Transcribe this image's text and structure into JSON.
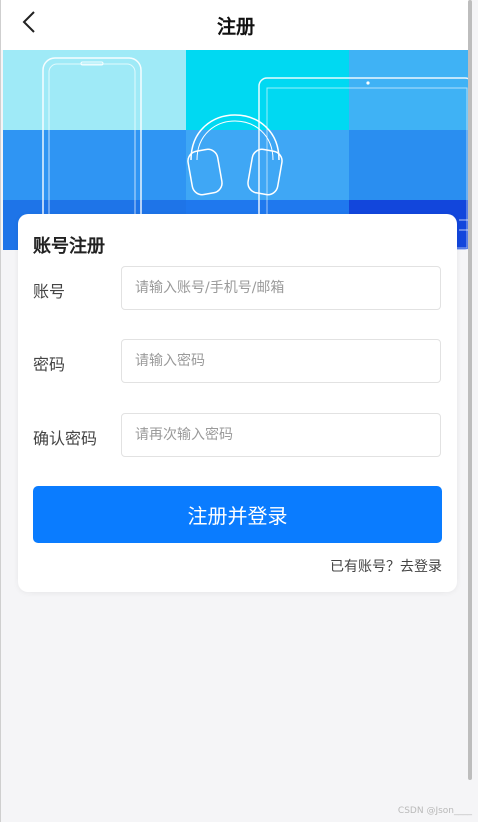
{
  "header": {
    "title": "注册"
  },
  "card": {
    "title": "账号注册",
    "fields": [
      {
        "label": "账号",
        "placeholder": "请输入账号/手机号/邮箱",
        "value": ""
      },
      {
        "label": "密码",
        "placeholder": "请输入密码",
        "value": ""
      },
      {
        "label": "确认密码",
        "placeholder": "请再次输入密码",
        "value": ""
      }
    ],
    "submit_label": "注册并登录",
    "login_link": "已有账号？去登录"
  },
  "watermark": "CSDN @Json____",
  "colors": {
    "primary": "#0a7cff",
    "background": "#f5f5f7",
    "banner_light": "#9feaf7",
    "banner_cyan": "#00d9f2",
    "banner_blue": "#2f95f3",
    "banner_dark": "#1246dc"
  }
}
